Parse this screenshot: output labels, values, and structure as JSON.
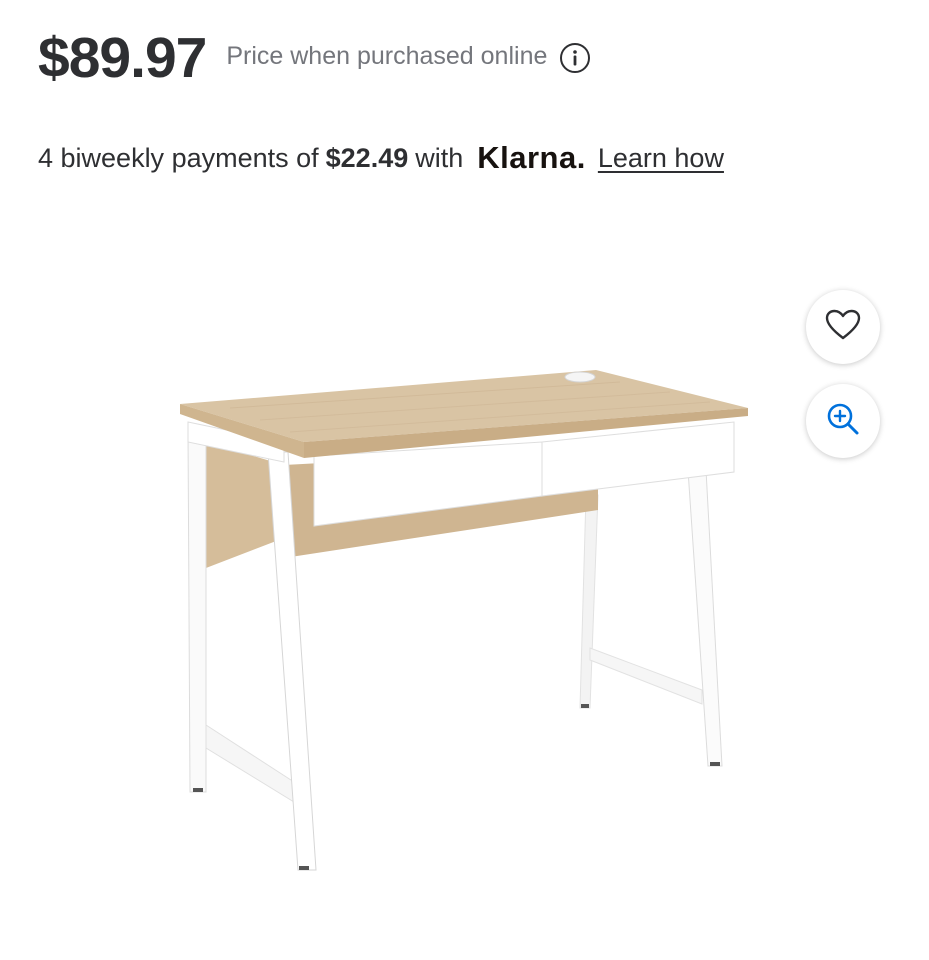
{
  "price": {
    "amount": "$89.97",
    "note": "Price when purchased online",
    "info_icon": "info-circle-icon"
  },
  "klarna": {
    "prefix": "4 biweekly payments of",
    "amount": "$22.49",
    "with": "with",
    "logo_text": "Klarna.",
    "link_label": "Learn how"
  },
  "actions": {
    "favorite_icon": "heart-outline-icon",
    "zoom_icon": "zoom-in-icon"
  },
  "colors": {
    "price_text": "#2e2f32",
    "note_text": "#74767c",
    "zoom_accent": "#0071dc",
    "desk_top": "#d8c3a3",
    "desk_frame": "#ffffff"
  }
}
